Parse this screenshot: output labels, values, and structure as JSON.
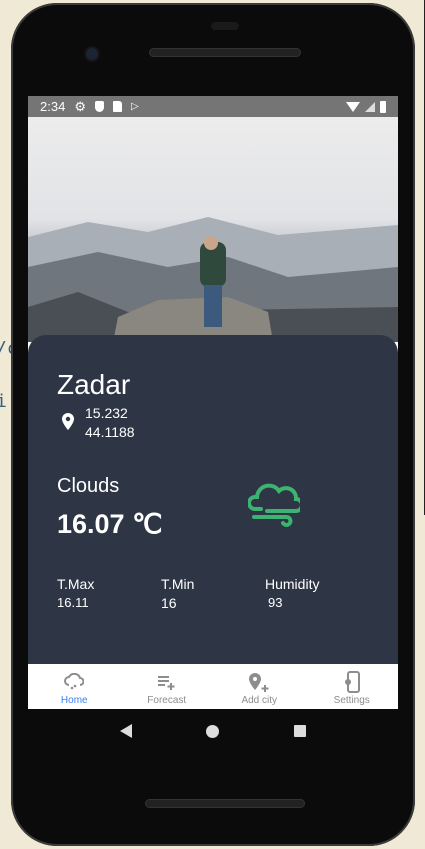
{
  "background_code": [
    "/c",
    "i"
  ],
  "status_bar": {
    "time": "2:34",
    "icons": [
      "gear-icon",
      "shield-icon",
      "sd-card-icon",
      "play-store-icon",
      "wifi-icon",
      "signal-icon",
      "battery-icon"
    ]
  },
  "city": {
    "name": "Zadar",
    "lon": "15.232",
    "lat": "44.1188"
  },
  "weather": {
    "condition": "Clouds",
    "temperature": "16.07 ℃",
    "icon": "cloud-wind-icon",
    "icon_color": "#3cb371"
  },
  "stats": [
    {
      "label": "T.Max",
      "value": "16.11"
    },
    {
      "label": "T.Min",
      "value": "16"
    },
    {
      "label": "Humidity",
      "value": "93"
    }
  ],
  "bottom_nav": [
    {
      "label": "Home",
      "icon": "cloud-icon",
      "active": true
    },
    {
      "label": "Forecast",
      "icon": "playlist-add-icon"
    },
    {
      "label": "Add city",
      "icon": "add-location-icon"
    },
    {
      "label": "Settings",
      "icon": "phone-settings-icon"
    }
  ],
  "colors": {
    "card": "#2e3646",
    "active": "#3b82f6",
    "status_bar": "#757575"
  }
}
